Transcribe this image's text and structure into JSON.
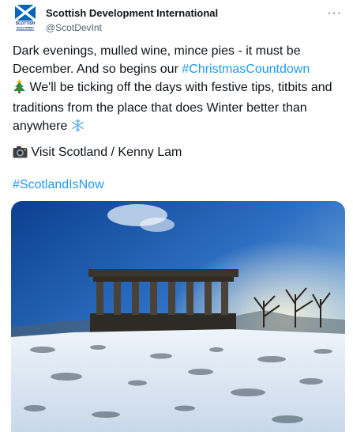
{
  "tweet": {
    "display_name": "Scottish Development International",
    "handle": "@ScotDevInt",
    "avatar_lines": [
      "SCOTTISH",
      "DEVELOPMENT",
      "INTERNATIONAL"
    ],
    "more_label": "···",
    "text_part1": "Dark evenings, mulled wine, mince pies - it must be December. And so begins our ",
    "hashtag1": "#ChristmasCountdown",
    "text_part2": " We'll be ticking off the days with festive tips, titbits and traditions from the place that does Winter better than anywhere ",
    "credit_text": " Visit Scotland / Kenny Lam",
    "hashtag2": "#ScotlandIsNow",
    "colors": {
      "link": "#1d9bf0",
      "secondary": "#536471"
    },
    "icons": [
      "christmas-tree-icon",
      "snowflake-icon",
      "camera-icon"
    ]
  }
}
